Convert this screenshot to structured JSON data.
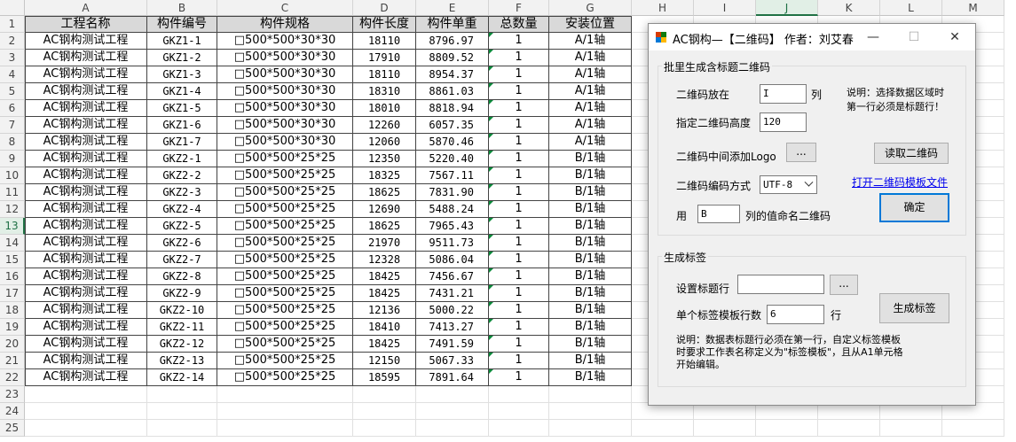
{
  "spreadsheet": {
    "columns": [
      "A",
      "B",
      "C",
      "D",
      "E",
      "F",
      "G",
      "H",
      "I",
      "J",
      "K",
      "L",
      "M"
    ],
    "selected_column": "J",
    "rows": [
      "1",
      "2",
      "3",
      "4",
      "5",
      "6",
      "7",
      "8",
      "9",
      "10",
      "11",
      "12",
      "13",
      "14",
      "15",
      "16",
      "17",
      "18",
      "19",
      "20",
      "21",
      "22",
      "23",
      "24",
      "25"
    ],
    "selected_row": "13",
    "header": [
      "工程名称",
      "构件编号",
      "构件规格",
      "构件长度",
      "构件单重",
      "总数量",
      "安装位置"
    ],
    "data": [
      [
        "AC钢构测试工程",
        "GKZ1-1",
        "□500*500*30*30",
        "18110",
        "8796.97",
        "1",
        "A/1轴"
      ],
      [
        "AC钢构测试工程",
        "GKZ1-2",
        "□500*500*30*30",
        "17910",
        "8809.52",
        "1",
        "A/1轴"
      ],
      [
        "AC钢构测试工程",
        "GKZ1-3",
        "□500*500*30*30",
        "18110",
        "8954.37",
        "1",
        "A/1轴"
      ],
      [
        "AC钢构测试工程",
        "GKZ1-4",
        "□500*500*30*30",
        "18310",
        "8861.03",
        "1",
        "A/1轴"
      ],
      [
        "AC钢构测试工程",
        "GKZ1-5",
        "□500*500*30*30",
        "18010",
        "8818.94",
        "1",
        "A/1轴"
      ],
      [
        "AC钢构测试工程",
        "GKZ1-6",
        "□500*500*30*30",
        "12260",
        "6057.35",
        "1",
        "A/1轴"
      ],
      [
        "AC钢构测试工程",
        "GKZ1-7",
        "□500*500*30*30",
        "12060",
        "5870.46",
        "1",
        "A/1轴"
      ],
      [
        "AC钢构测试工程",
        "GKZ2-1",
        "□500*500*25*25",
        "12350",
        "5220.40",
        "1",
        "B/1轴"
      ],
      [
        "AC钢构测试工程",
        "GKZ2-2",
        "□500*500*25*25",
        "18325",
        "7567.11",
        "1",
        "B/1轴"
      ],
      [
        "AC钢构测试工程",
        "GKZ2-3",
        "□500*500*25*25",
        "18625",
        "7831.90",
        "1",
        "B/1轴"
      ],
      [
        "AC钢构测试工程",
        "GKZ2-4",
        "□500*500*25*25",
        "12690",
        "5488.24",
        "1",
        "B/1轴"
      ],
      [
        "AC钢构测试工程",
        "GKZ2-5",
        "□500*500*25*25",
        "18625",
        "7965.43",
        "1",
        "B/1轴"
      ],
      [
        "AC钢构测试工程",
        "GKZ2-6",
        "□500*500*25*25",
        "21970",
        "9511.73",
        "1",
        "B/1轴"
      ],
      [
        "AC钢构测试工程",
        "GKZ2-7",
        "□500*500*25*25",
        "12328",
        "5086.04",
        "1",
        "B/1轴"
      ],
      [
        "AC钢构测试工程",
        "GKZ2-8",
        "□500*500*25*25",
        "18425",
        "7456.67",
        "1",
        "B/1轴"
      ],
      [
        "AC钢构测试工程",
        "GKZ2-9",
        "□500*500*25*25",
        "18425",
        "7431.21",
        "1",
        "B/1轴"
      ],
      [
        "AC钢构测试工程",
        "GKZ2-10",
        "□500*500*25*25",
        "12136",
        "5000.22",
        "1",
        "B/1轴"
      ],
      [
        "AC钢构测试工程",
        "GKZ2-11",
        "□500*500*25*25",
        "18410",
        "7413.27",
        "1",
        "B/1轴"
      ],
      [
        "AC钢构测试工程",
        "GKZ2-12",
        "□500*500*25*25",
        "18425",
        "7491.59",
        "1",
        "B/1轴"
      ],
      [
        "AC钢构测试工程",
        "GKZ2-13",
        "□500*500*25*25",
        "12150",
        "5067.33",
        "1",
        "B/1轴"
      ],
      [
        "AC钢构测试工程",
        "GKZ2-14",
        "□500*500*25*25",
        "18595",
        "7891.64",
        "1",
        "B/1轴"
      ]
    ]
  },
  "dialog": {
    "title": "AC钢构—【二维码】 作者：刘艾春",
    "minimize_glyph": "—",
    "maximize_glyph": "☐",
    "close_glyph": "✕",
    "qr_group": {
      "label": "批里生成含标题二维码",
      "place_label": "二维码放在",
      "place_value": "I",
      "place_suffix": "列",
      "note": "说明：选择数据区域时\n第一行必须是标题行！",
      "height_label": "指定二维码高度",
      "height_value": "120",
      "logo_label": "二维码中间添加Logo",
      "logo_button": "...",
      "read_button": "读取二维码",
      "encoding_label": "二维码编码方式",
      "encoding_value": "UTF-8",
      "template_link": "打开二维码模板文件",
      "name_prefix": "用",
      "name_value": "B",
      "name_suffix": "列的值命名二维码",
      "ok_button": "确定"
    },
    "label_group": {
      "label": "生成标签",
      "title_row_label": "设置标题行",
      "title_row_value": "",
      "title_row_button": "...",
      "generate_button": "生成标签",
      "rows_label": "单个标签模板行数",
      "rows_value": "6",
      "rows_suffix": "行",
      "note": "说明：数据表标题行必须在第一行，自定义标签模板\n时要求工作表名称定义为\"标签模板\"，且从A1单元格\n开始编辑。"
    }
  },
  "colors": {
    "header_fill": "#d9d9d9",
    "excel_green": "#217346",
    "link": "#0000ee",
    "default_button_border": "#0078d7"
  }
}
